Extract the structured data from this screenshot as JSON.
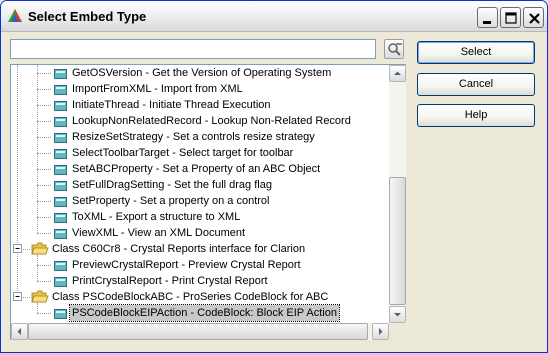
{
  "window": {
    "title": "Select Embed Type"
  },
  "icons": {
    "app": "triangle-logo-icon",
    "minimize": "minimize-icon",
    "maximize": "maximize-icon",
    "close": "close-icon",
    "search": "search-icon",
    "procedure": "procedure-icon",
    "folder": "folder-open-icon"
  },
  "search": {
    "value": "",
    "placeholder": ""
  },
  "buttons": {
    "select": "Select",
    "cancel": "Cancel",
    "help": "Help"
  },
  "tree": {
    "items": [
      {
        "text": "GetOSVersion - Get the Version of Operating System",
        "level": 2,
        "type": "procedure"
      },
      {
        "text": "ImportFromXML - Import from XML",
        "level": 2,
        "type": "procedure"
      },
      {
        "text": "InitiateThread - Initiate Thread Execution",
        "level": 2,
        "type": "procedure"
      },
      {
        "text": "LookupNonRelatedRecord - Lookup Non-Related Record",
        "level": 2,
        "type": "procedure"
      },
      {
        "text": "ResizeSetStrategy - Set a controls resize strategy",
        "level": 2,
        "type": "procedure"
      },
      {
        "text": "SelectToolbarTarget - Select target for toolbar",
        "level": 2,
        "type": "procedure"
      },
      {
        "text": "SetABCProperty - Set a Property of an ABC Object",
        "level": 2,
        "type": "procedure"
      },
      {
        "text": "SetFullDragSetting - Set the full drag flag",
        "level": 2,
        "type": "procedure"
      },
      {
        "text": "SetProperty - Set a property on a control",
        "level": 2,
        "type": "procedure"
      },
      {
        "text": "ToXML - Export a structure to XML",
        "level": 2,
        "type": "procedure"
      },
      {
        "text": "ViewXML - View an XML Document",
        "level": 2,
        "type": "procedure"
      },
      {
        "text": "Class C60Cr8 - Crystal Reports interface for Clarion",
        "level": 1,
        "type": "folder",
        "expanded": true
      },
      {
        "text": "PreviewCrystalReport - Preview Crystal Report",
        "level": 2,
        "type": "procedure"
      },
      {
        "text": "PrintCrystalReport - Print Crystal Report",
        "level": 2,
        "type": "procedure"
      },
      {
        "text": "Class PSCodeBlockABC - ProSeries CodeBlock for ABC",
        "level": 1,
        "type": "folder",
        "expanded": true
      },
      {
        "text": "PSCodeBlockEIPAction - CodeBlock: Block EIP Action",
        "level": 2,
        "type": "procedure",
        "selected": true
      }
    ]
  }
}
